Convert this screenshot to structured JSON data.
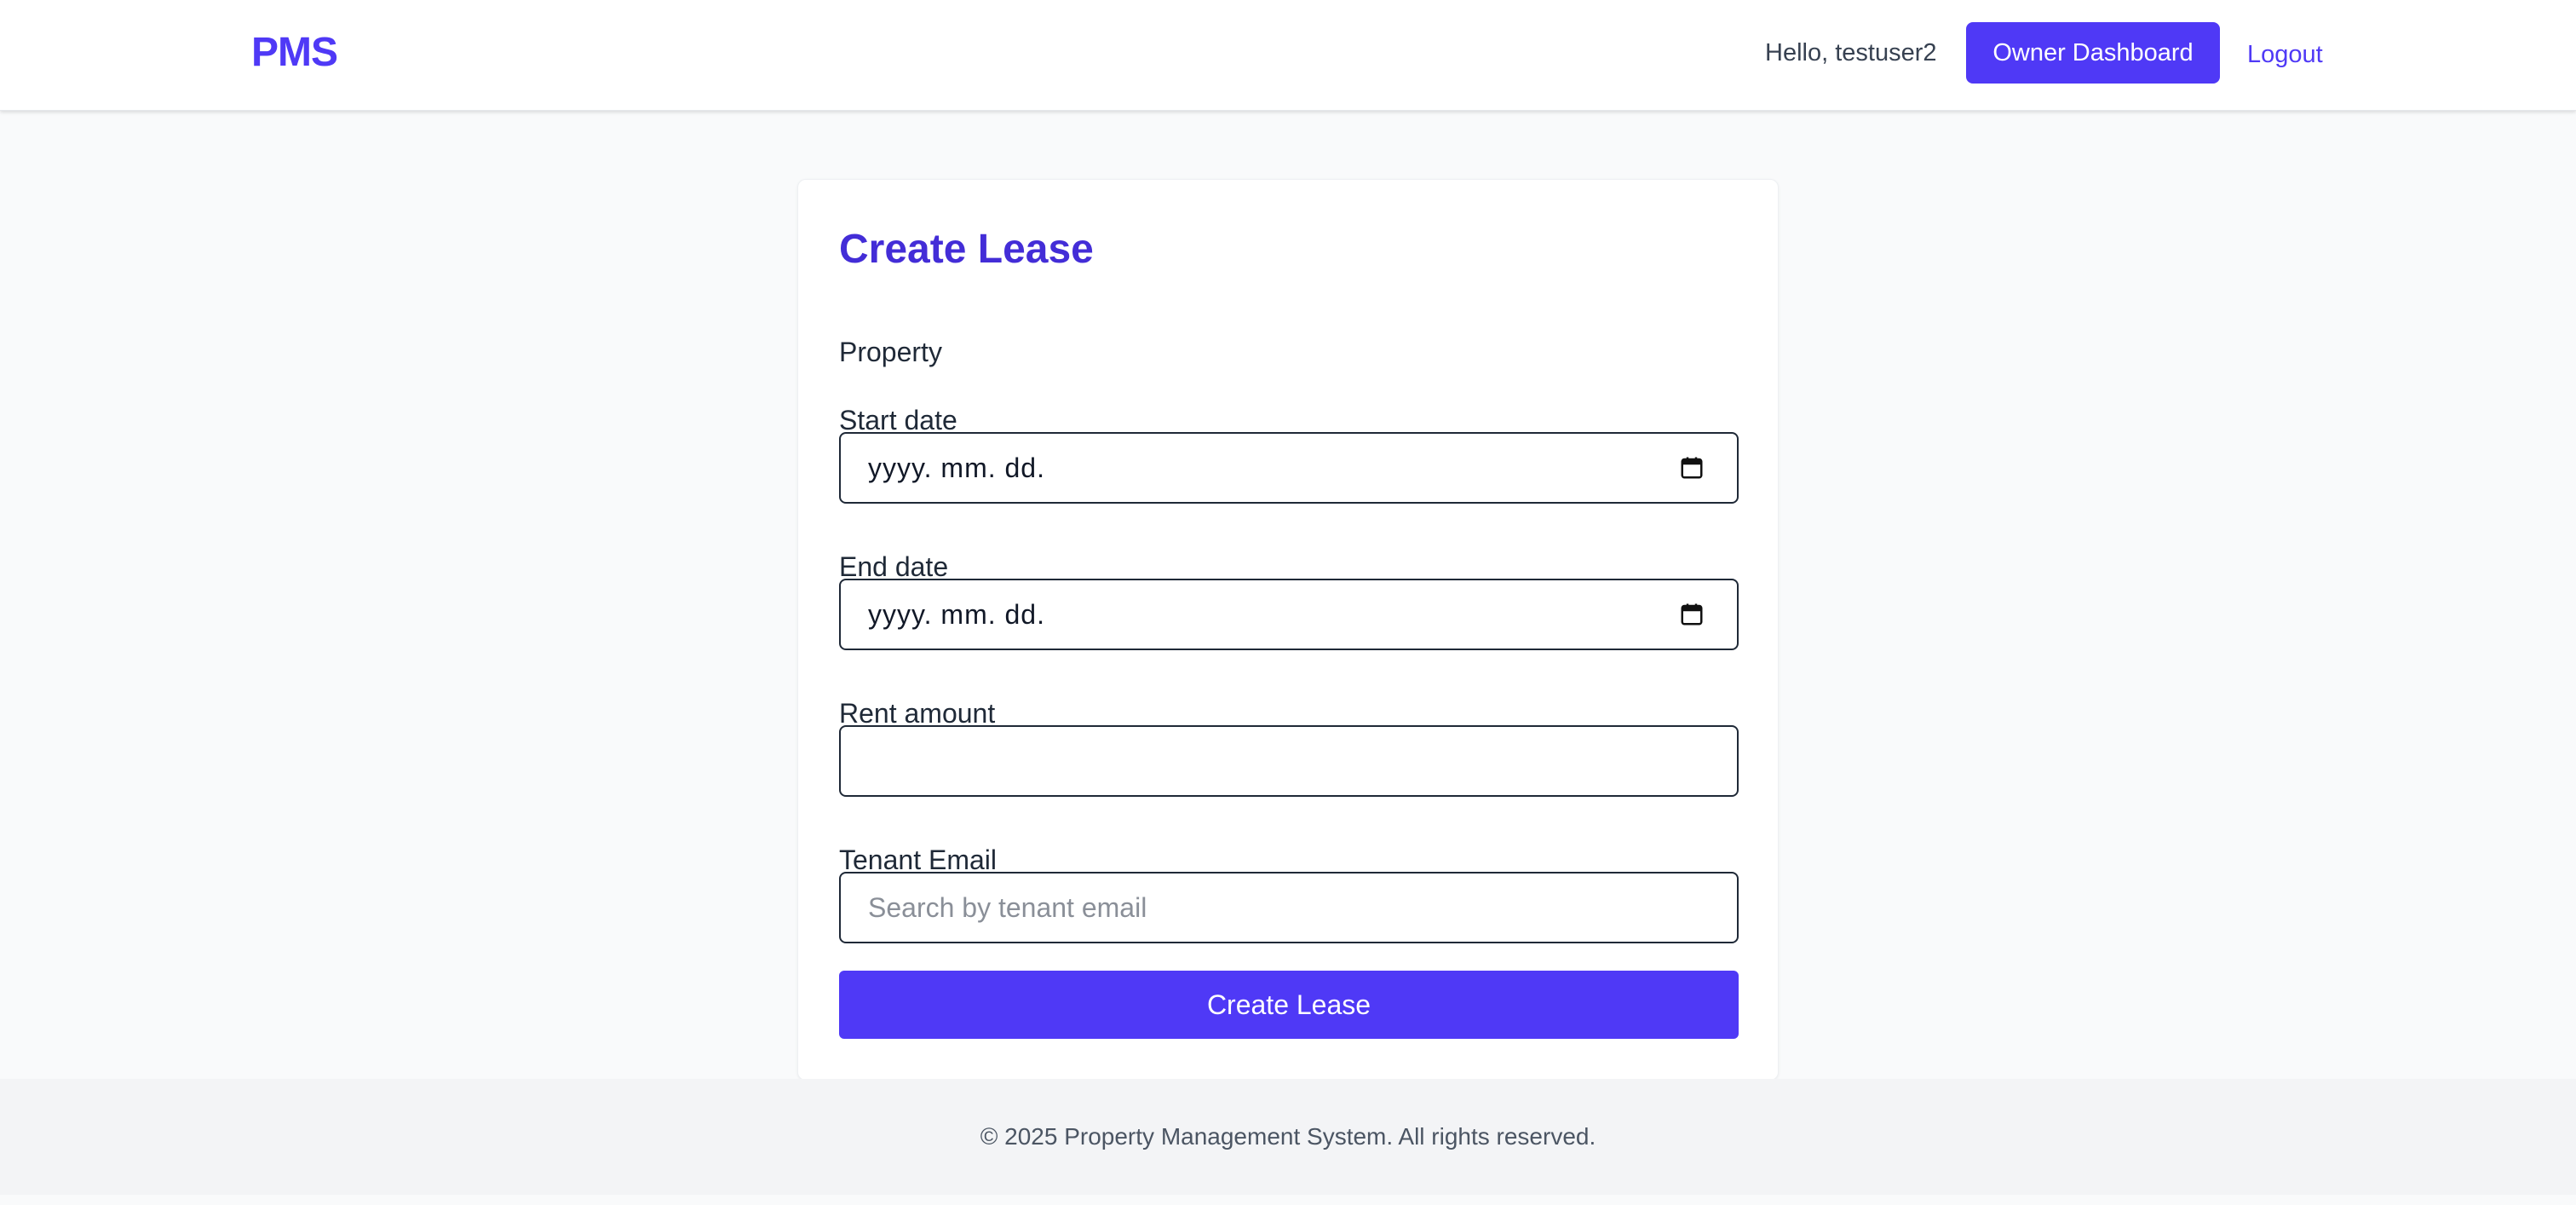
{
  "header": {
    "logo": "PMS",
    "greeting": "Hello, testuser2",
    "dashboard_button": "Owner Dashboard",
    "logout": "Logout"
  },
  "form": {
    "title": "Create Lease",
    "property_label": "Property",
    "start_date": {
      "label": "Start date",
      "value_placeholder": "yyyy. mm. dd.",
      "icon": "calendar-icon"
    },
    "end_date": {
      "label": "End date",
      "value_placeholder": "yyyy. mm. dd.",
      "icon": "calendar-icon"
    },
    "rent_amount": {
      "label": "Rent amount",
      "value": ""
    },
    "tenant_email": {
      "label": "Tenant Email",
      "placeholder": "Search by tenant email",
      "value": ""
    },
    "submit_label": "Create Lease"
  },
  "footer": {
    "copyright": "© 2025 Property Management System. All rights reserved."
  },
  "colors": {
    "accent": "#4f39f6",
    "title": "#432dd7",
    "background": "#f9fafb",
    "footer_bg": "#f3f4f6"
  }
}
